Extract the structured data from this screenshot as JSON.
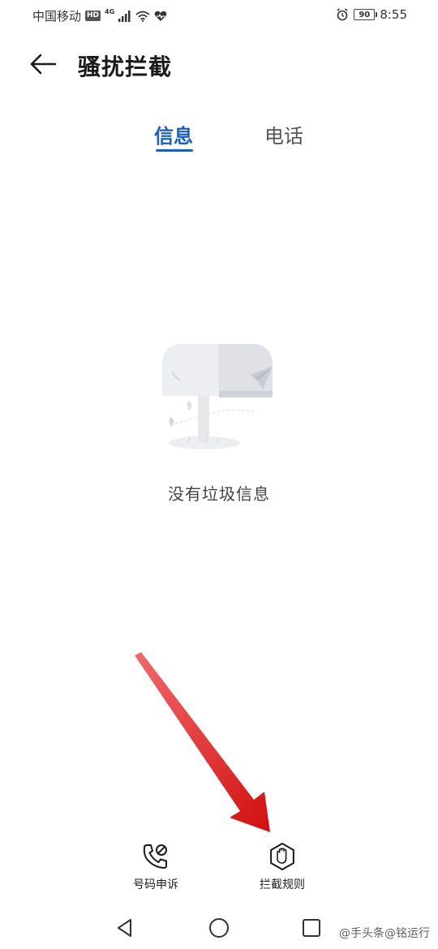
{
  "status_bar": {
    "carrier": "中国移动",
    "hd_badge": "HD",
    "network": "4G",
    "battery": "90",
    "time": "8:55"
  },
  "header": {
    "title": "骚扰拦截"
  },
  "tabs": [
    {
      "label": "信息",
      "active": true
    },
    {
      "label": "电话",
      "active": false
    }
  ],
  "empty_state": {
    "message": "没有垃圾信息"
  },
  "bottom_actions": [
    {
      "label": "号码申诉",
      "icon": "phone-appeal-icon"
    },
    {
      "label": "拦截规则",
      "icon": "hand-stop-icon"
    }
  ],
  "watermark": "@手头条@铭运行",
  "colors": {
    "accent": "#1a5fc0",
    "arrow": "#e01a1a",
    "text": "#1a1a1a"
  }
}
